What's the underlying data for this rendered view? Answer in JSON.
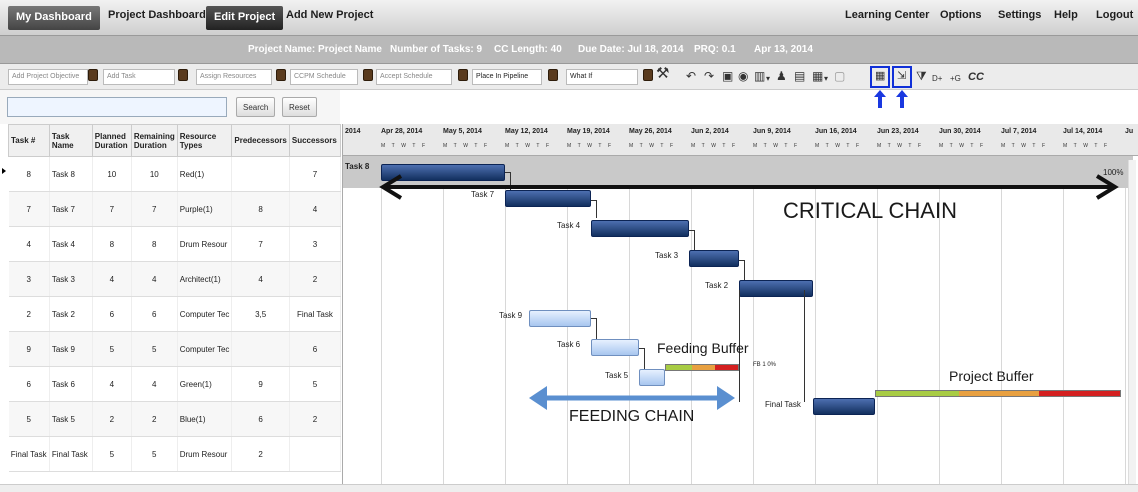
{
  "nav": {
    "my_dashboard": "My Dashboard",
    "project_dashboard": "Project Dashboard",
    "edit_project": "Edit Project",
    "add_new_project": "Add New Project",
    "learning_center": "Learning Center",
    "options": "Options",
    "settings": "Settings",
    "help": "Help",
    "logout": "Logout"
  },
  "info": {
    "project_name": "Project Name: Project Name",
    "number_of_tasks": "Number of Tasks: 9",
    "cc_length": "CC Length: 40",
    "due_date": "Due Date: Jul 18, 2014",
    "prq": "PRQ: 0.1",
    "start_date": "Apr 13, 2014"
  },
  "toolbar": {
    "add_project_objective": "Add Project Objective",
    "add_task": "Add Task",
    "assign_resources": "Assign Resources",
    "ccpm_schedule": "CCPM Schedule",
    "accept_schedule": "Accept Schedule",
    "place_in_pipeline": "Place In Pipeline",
    "what_if": "What If",
    "filter_1": "D+",
    "filter_2": "+G",
    "cc": "CC"
  },
  "search": {
    "search_label": "Search",
    "reset_label": "Reset",
    "value": ""
  },
  "table": {
    "headers": [
      "Task #",
      "Task Name",
      "Planned Duration",
      "Remaining Duration",
      "Resource Types",
      "Predecessors",
      "Successors"
    ],
    "rows": [
      [
        "8",
        "Task 8",
        "10",
        "10",
        "Red(1)",
        "",
        "7"
      ],
      [
        "7",
        "Task 7",
        "7",
        "7",
        "Purple(1)",
        "8",
        "4"
      ],
      [
        "4",
        "Task 4",
        "8",
        "8",
        "Drum Resour",
        "7",
        "3"
      ],
      [
        "3",
        "Task 3",
        "4",
        "4",
        "Architect(1)",
        "4",
        "2"
      ],
      [
        "2",
        "Task 2",
        "6",
        "6",
        "Computer Tec",
        "3,5",
        "Final Task"
      ],
      [
        "9",
        "Task 9",
        "5",
        "5",
        "Computer Tec",
        "",
        "6"
      ],
      [
        "6",
        "Task 6",
        "4",
        "4",
        "Green(1)",
        "9",
        "5"
      ],
      [
        "5",
        "Task 5",
        "2",
        "2",
        "Blue(1)",
        "6",
        "2"
      ],
      [
        "Final Task",
        "Final Task",
        "5",
        "5",
        "Drum Resour",
        "2",
        ""
      ]
    ]
  },
  "gantt": {
    "weeks": [
      "2014",
      "Apr 28, 2014",
      "May 5, 2014",
      "May 12, 2014",
      "May 19, 2014",
      "May 26, 2014",
      "Jun 2, 2014",
      "Jun 9, 2014",
      "Jun 16, 2014",
      "Jun 23, 2014",
      "Jun 30, 2014",
      "Jul 7, 2014",
      "Jul 14, 2014",
      "Ju"
    ],
    "day_letters": "M T W T F",
    "task8_row_label": "Task 8",
    "percent": "100%",
    "labels": {
      "task7": "Task 7",
      "task4": "Task 4",
      "task3": "Task 3",
      "task2": "Task 2",
      "task9": "Task 9",
      "task6": "Task 6",
      "task5": "Task 5",
      "final_task": "Final Task",
      "fb": "FB 1 0%"
    },
    "annotations": {
      "critical_chain": "CRITICAL CHAIN",
      "feeding_chain": "FEEDING  CHAIN",
      "feeding_buffer": "Feeding Buffer",
      "project_buffer": "Project Buffer"
    },
    "colors": {
      "bar_dark": "#1b3a70",
      "bar_light": "#c9dcf5",
      "buffer_green": "#a8cc44",
      "buffer_orange": "#e8a040",
      "buffer_red": "#d42020",
      "highlight": "#1030d8",
      "feeding_arrow": "#5a8fd0"
    }
  }
}
